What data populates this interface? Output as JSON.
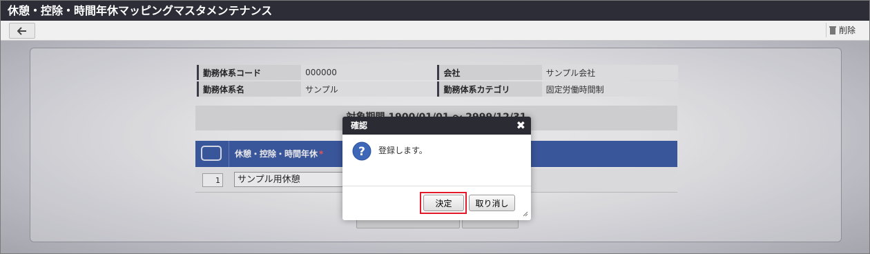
{
  "window": {
    "title": "休憩・控除・時間年休マッピングマスタメンテナンス"
  },
  "toolbar": {
    "back_icon": "arrow-left-icon",
    "delete_label": "削除",
    "delete_icon": "trash-icon"
  },
  "info": {
    "rows": [
      {
        "k1": "勤務体系コード",
        "v1": "000000",
        "k2": "会社",
        "v2": "サンプル会社"
      },
      {
        "k1": "勤務体系名",
        "v1": "サンプル",
        "k2": "勤務体系カテゴリ",
        "v2": "固定労働時間制"
      }
    ]
  },
  "period": {
    "label": "対象期間 1900/01/01 ～ 2999/12/31"
  },
  "grid": {
    "header": "休憩・控除・時間年休",
    "required_mark": "*",
    "rows": [
      {
        "num": "1",
        "value": "サンプル用休憩"
      }
    ]
  },
  "dialog": {
    "title": "確認",
    "message": "登録します。",
    "ok_label": "決定",
    "cancel_label": "取り消し",
    "colors": {
      "header": "#2b2b33",
      "highlight": "#e0182a"
    }
  },
  "colors": {
    "titlebar": "#2d2d38",
    "grid_header": "#3b5ba7"
  }
}
